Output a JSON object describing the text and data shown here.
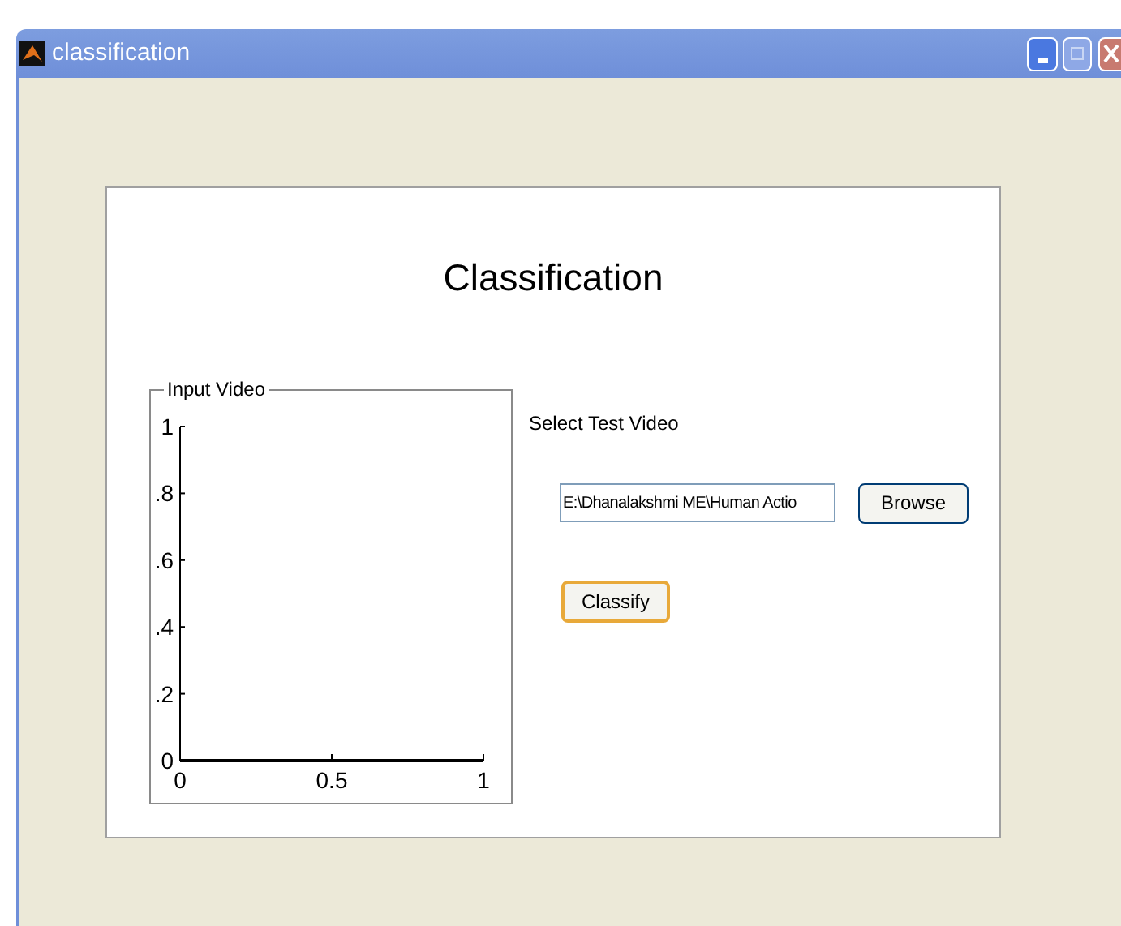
{
  "window": {
    "title": "classification"
  },
  "heading": "Classification",
  "input_video": {
    "title": "Input Video",
    "chart_data": {
      "type": "line",
      "xlim": [
        0,
        1
      ],
      "ylim": [
        0,
        1
      ],
      "xticks": [
        {
          "value": 0,
          "label": "0"
        },
        {
          "value": 0.5,
          "label": "0.5"
        },
        {
          "value": 1,
          "label": "1"
        }
      ],
      "yticks": [
        {
          "value": 0,
          "label": "0"
        },
        {
          "value": 0.2,
          "label": ".2"
        },
        {
          "value": 0.4,
          "label": ".4"
        },
        {
          "value": 0.6,
          "label": ".6"
        },
        {
          "value": 0.8,
          "label": ".8"
        },
        {
          "value": 1,
          "label": "1"
        }
      ]
    }
  },
  "select_label": "Select Test Video",
  "path_field": {
    "value": "E:\\Dhanalakshmi ME\\Human Actio"
  },
  "buttons": [
    {
      "label": "Browse",
      "kind": "plain"
    },
    {
      "label": "Classify",
      "kind": "focused"
    }
  ]
}
